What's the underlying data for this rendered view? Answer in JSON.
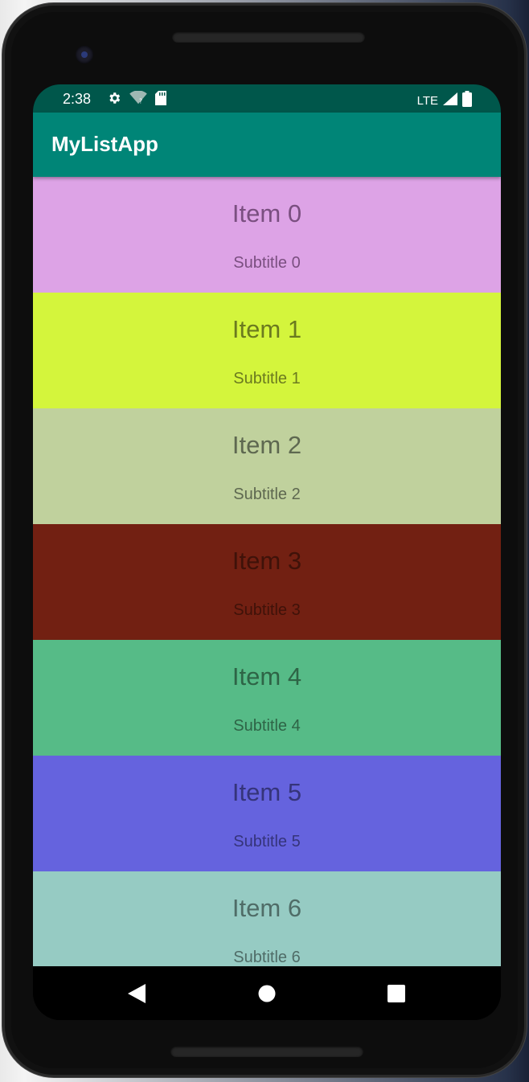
{
  "status_bar": {
    "time": "2:38",
    "network": "LTE",
    "color": "#00574b",
    "icons": [
      "settings-icon",
      "wifi-icon",
      "sd-card-icon",
      "signal-icon",
      "battery-icon"
    ]
  },
  "app_bar": {
    "title": "MyListApp",
    "color": "#008577"
  },
  "list": {
    "items": [
      {
        "title": "Item 0",
        "subtitle": "Subtitle 0",
        "background": "#dda3e6",
        "text_color": "#7a4f80"
      },
      {
        "title": "Item 1",
        "subtitle": "Subtitle 1",
        "background": "#d4f53c",
        "text_color": "#6b7a1f"
      },
      {
        "title": "Item 2",
        "subtitle": "Subtitle 2",
        "background": "#c0d19d",
        "text_color": "#5e6850"
      },
      {
        "title": "Item 3",
        "subtitle": "Subtitle 3",
        "background": "#722012",
        "text_color": "#3f1209"
      },
      {
        "title": "Item 4",
        "subtitle": "Subtitle 4",
        "background": "#56bb87",
        "text_color": "#2e6446"
      },
      {
        "title": "Item 5",
        "subtitle": "Subtitle 5",
        "background": "#6563de",
        "text_color": "#35347a"
      },
      {
        "title": "Item 6",
        "subtitle": "Subtitle 6",
        "background": "#96cbc3",
        "text_color": "#4f6c67"
      }
    ]
  },
  "nav_bar": {
    "buttons": [
      "back-icon",
      "home-icon",
      "recents-icon"
    ]
  }
}
